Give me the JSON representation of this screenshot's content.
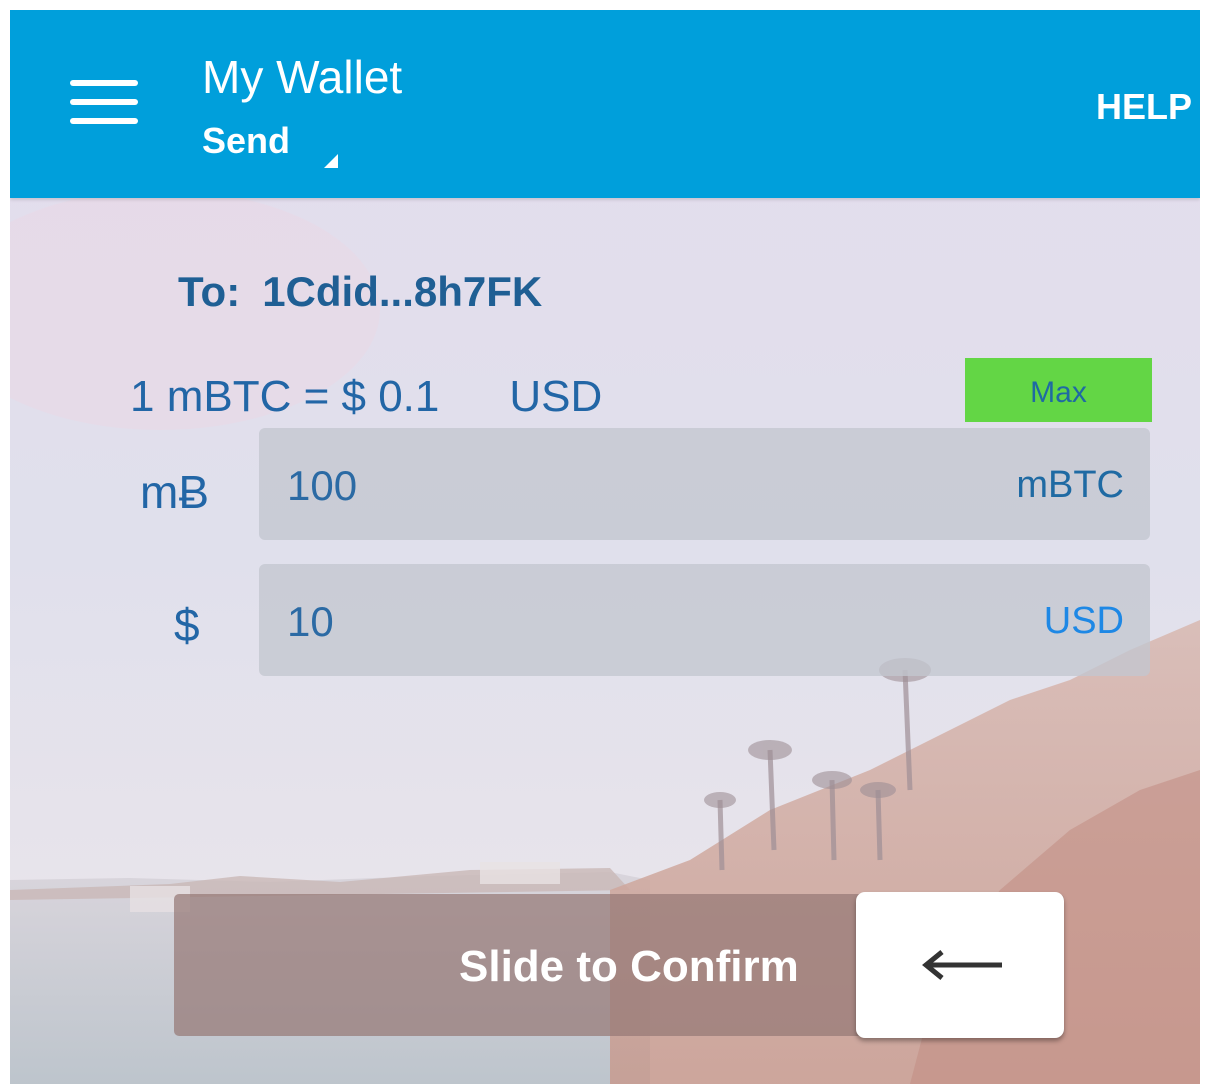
{
  "header": {
    "menu_icon": "hamburger-menu-icon",
    "title": "My Wallet",
    "subtitle": "Send",
    "help_label": "HELP",
    "bar_color": "#009fdb"
  },
  "recipient": {
    "label": "To:",
    "address": "1Cdid...8h7FK"
  },
  "rate": {
    "text": "1 mBTC = $ 0.1",
    "currency": "USD"
  },
  "max_button": {
    "label": "Max",
    "color": "#63d645"
  },
  "btc_field": {
    "symbol": "mɃ",
    "value": "100",
    "unit": "mBTC"
  },
  "usd_field": {
    "symbol": "$",
    "value": "10",
    "unit": "USD"
  },
  "confirm_slider": {
    "label": "Slide to Confirm",
    "knob_icon": "arrow-left-icon"
  }
}
